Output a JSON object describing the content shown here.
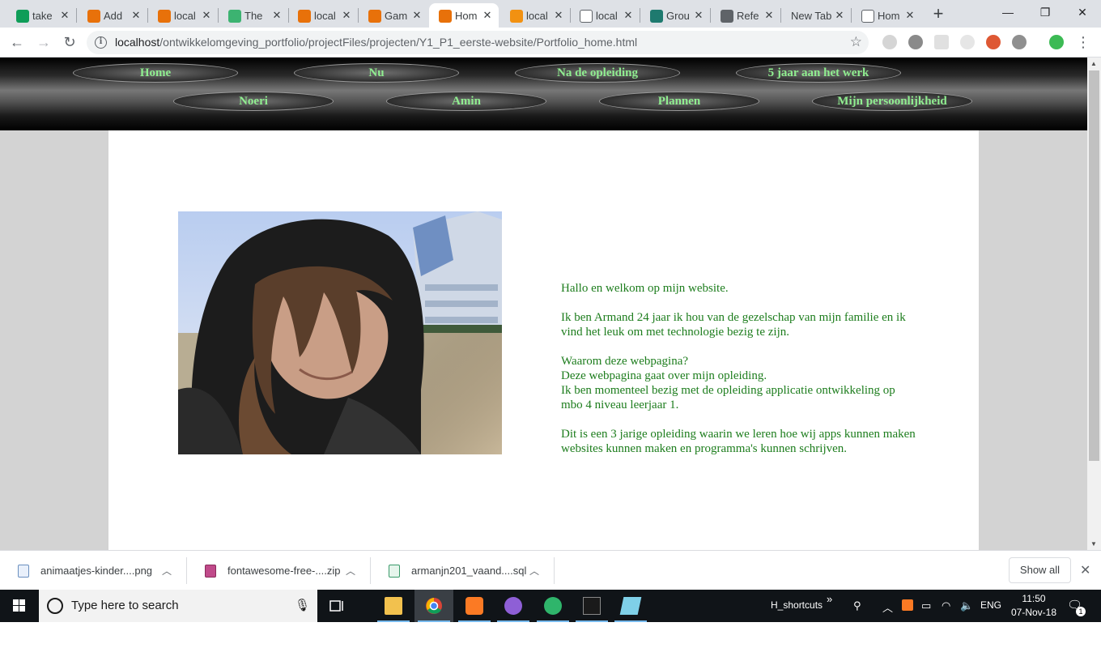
{
  "browser": {
    "tabs": [
      {
        "title": "take",
        "favicon_color": "#0f9d58",
        "active": false
      },
      {
        "title": "Add",
        "favicon_color": "#e8710a",
        "active": false
      },
      {
        "title": "local",
        "favicon_color": "#e8710a",
        "active": false
      },
      {
        "title": "The",
        "favicon_color": "#3cb371",
        "active": false
      },
      {
        "title": "local",
        "favicon_color": "#e8710a",
        "active": false
      },
      {
        "title": "Gam",
        "favicon_color": "#e8710a",
        "active": false
      },
      {
        "title": "Hom",
        "favicon_color": "#e8710a",
        "active": true
      },
      {
        "title": "local",
        "favicon_color": "#f29111",
        "active": false
      },
      {
        "title": "local",
        "favicon_color": "#ffffff",
        "active": false
      },
      {
        "title": "Grou",
        "favicon_color": "#1e7a6f",
        "active": false
      },
      {
        "title": "Refe",
        "favicon_color": "#5f6368",
        "active": false
      },
      {
        "title": "New Tab",
        "favicon_color": "",
        "active": false
      },
      {
        "title": "Hom",
        "favicon_color": "#ffffff",
        "active": false
      }
    ],
    "new_tab_symbol": "+",
    "window_controls": {
      "minimize": "—",
      "maximize": "❐",
      "close": "✕"
    },
    "address": {
      "host": "localhost",
      "path": "/ontwikkelomgeving_portfolio/projectFiles/projecten/Y1_P1_eerste-website/Portfolio_home.html"
    },
    "extensions": [
      "opera-icon",
      "adblock-icon",
      "grid-icon",
      "react-icon",
      "duckduckgo-icon",
      "gear-icon",
      "profile-icon"
    ]
  },
  "page": {
    "nav_row1": [
      "Home",
      "Nu",
      "Na de opleiding",
      "5 jaar aan het werk"
    ],
    "nav_row2": [
      "Noeri",
      "Amin",
      "Plannen",
      "Mijn persoonlijkheid"
    ],
    "paragraphs": [
      "Hallo en welkom op mijn website.",
      "Ik ben Armand 24 jaar ik hou van de gezelschap van mijn familie en ik vind het leuk om met technologie bezig te zijn.",
      "Waarom deze webpagina?\nDeze webpagina gaat over mijn opleiding.\nIk ben momenteel bezig met de opleiding applicatie ontwikkeling op mbo 4 niveau leerjaar 1.",
      "Dit is een 3 jarige opleiding waarin we leren hoe wij apps kunnen maken websites kunnen maken en programma's kunnen schrijven."
    ],
    "colors": {
      "nav_text": "#90ee90",
      "body_text": "#1d7d1d",
      "page_bg": "#d3d3d3"
    }
  },
  "downloads": {
    "items": [
      {
        "name": "animaatjes-kinder....png"
      },
      {
        "name": "fontawesome-free-....zip"
      },
      {
        "name": "armanjn201_vaand....sql"
      }
    ],
    "show_all": "Show all"
  },
  "taskbar": {
    "search_placeholder": "Type here to search",
    "toolbar_label": "H_shortcuts",
    "language": "ENG",
    "time": "11:50",
    "date": "07-Nov-18",
    "notification_count": "1"
  }
}
